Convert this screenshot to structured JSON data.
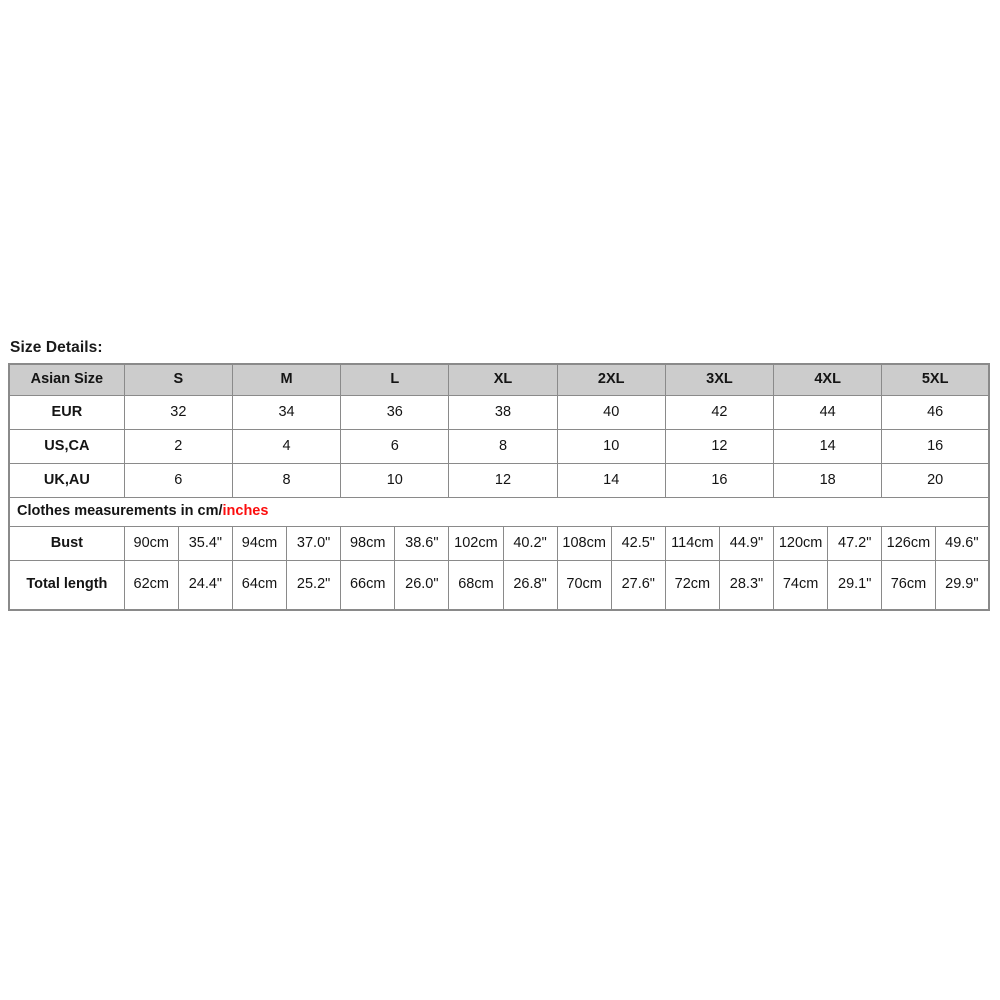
{
  "page": {
    "title": "Size Details:",
    "background_color": "#ffffff",
    "header_background_color": "#cccccc",
    "border_color": "#8a8a8a",
    "accent_color": "#fc0d0d",
    "text_color": "#141414"
  },
  "chart_data": {
    "type": "table",
    "title": "Size Details:",
    "size_label": "Asian Size",
    "sizes": [
      "S",
      "M",
      "L",
      "XL",
      "2XL",
      "3XL",
      "4XL",
      "5XL"
    ],
    "conversion_rows": [
      {
        "label": "EUR",
        "values": [
          "32",
          "34",
          "36",
          "38",
          "40",
          "42",
          "44",
          "46"
        ]
      },
      {
        "label": "US,CA",
        "values": [
          "2",
          "4",
          "6",
          "8",
          "10",
          "12",
          "14",
          "16"
        ]
      },
      {
        "label": "UK,AU",
        "values": [
          "6",
          "8",
          "10",
          "12",
          "14",
          "16",
          "18",
          "20"
        ]
      }
    ],
    "note": {
      "prefix": "Clothes measurements in cm/",
      "highlight": "inches",
      "full": "Clothes measurements in cm/inches"
    },
    "measurement_rows": [
      {
        "label": "Bust",
        "cm": [
          "90cm",
          "94cm",
          "98cm",
          "102cm",
          "108cm",
          "114cm",
          "120cm",
          "126cm"
        ],
        "inches": [
          "35.4\"",
          "37.0\"",
          "38.6\"",
          "40.2\"",
          "42.5\"",
          "44.9\"",
          "47.2\"",
          "49.6\""
        ]
      },
      {
        "label": "Total length",
        "cm": [
          "62cm",
          "64cm",
          "66cm",
          "68cm",
          "70cm",
          "72cm",
          "74cm",
          "76cm"
        ],
        "inches": [
          "24.4\"",
          "25.2\"",
          "26.0\"",
          "26.8\"",
          "27.6\"",
          "28.3\"",
          "29.1\"",
          "29.9\""
        ]
      }
    ]
  }
}
